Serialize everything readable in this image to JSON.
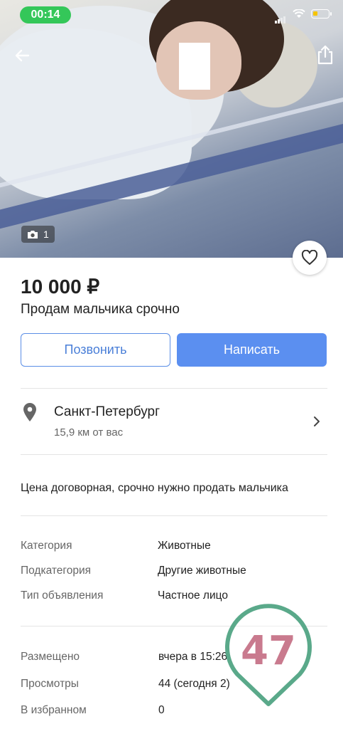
{
  "status_bar": {
    "time": "00:14"
  },
  "photo": {
    "count": "1"
  },
  "listing": {
    "price": "10 000 ₽",
    "title": "Продам мальчика срочно"
  },
  "actions": {
    "call_label": "Позвонить",
    "write_label": "Написать"
  },
  "location": {
    "city": "Санкт-Петербург",
    "distance": "15,9 км от вас"
  },
  "description": "Цена договорная, срочно нужно продать мальчика",
  "properties": [
    {
      "label": "Категория",
      "value": "Животные"
    },
    {
      "label": "Подкатегория",
      "value": "Другие животные"
    },
    {
      "label": "Тип объявления",
      "value": "Частное лицо"
    }
  ],
  "stats": [
    {
      "label": "Размещено",
      "value": "вчера в 15:26"
    },
    {
      "label": "Просмотры",
      "value": "44 (сегодня 2)"
    },
    {
      "label": "В избранном",
      "value": "0"
    }
  ],
  "watermark": {
    "text": "47",
    "color": "#c97a8e",
    "ring_color": "#5aa98a"
  },
  "colors": {
    "accent": "#5b8ff0",
    "status_green": "#34c759"
  }
}
